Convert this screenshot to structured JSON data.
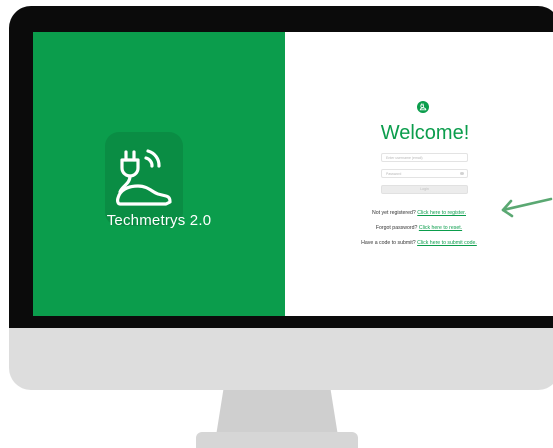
{
  "app": {
    "name": "Techmetrys 2.0"
  },
  "login": {
    "heading": "Welcome!",
    "username_placeholder": "Enter username (email)",
    "password_placeholder": "Password",
    "submit_label": "Login"
  },
  "links": [
    {
      "prompt": "Not yet registered?",
      "link": "Click here to register."
    },
    {
      "prompt": "Forgot password?",
      "link": "Click here to reset."
    },
    {
      "prompt": "Have a code to submit?",
      "link": "Click here to submit code."
    }
  ],
  "colors": {
    "brand_green": "#0b9d4c",
    "arrow": "#5aa872",
    "bezel": "#0b0b0b",
    "chin": "#dddddd"
  },
  "icons": [
    "plug-car-logo-icon",
    "plug-car-small-icon",
    "eye-icon",
    "arrow-icon"
  ]
}
